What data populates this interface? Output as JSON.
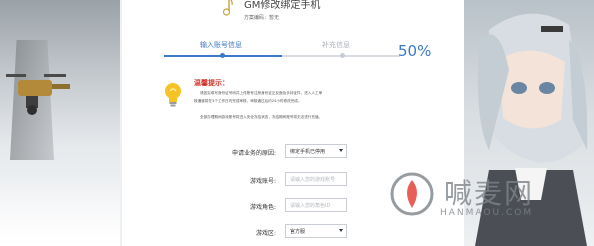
{
  "header": {
    "title": "GM修改绑定手机",
    "subtitle": "方案编码：暂无"
  },
  "progress": {
    "step1_label": "输入账号信息",
    "step2_label": "补充信息",
    "percent_text": "50%",
    "fraction": 0.5,
    "accent": "#3b78c7",
    "inactive": "#a9b1ba"
  },
  "tip": {
    "title": "温馨提示：",
    "title_color": "#d6322b",
    "lines": [
      "请如实填写身份证号码并上传账号注册身份证正反面及手持证件，进入人工审",
      "核通道将在3个工作日内完成审核，审核通过后约24小时修改完成。",
      "",
      "全部办理期间游戏账号将进入安全冻结状态，冻结期间账号将无法进行充值。"
    ]
  },
  "form": {
    "reason": {
      "label": "申请业务的原因:",
      "value": "绑定手机已停用"
    },
    "account": {
      "label": "游戏账号:",
      "placeholder": "请输入您的游戏账号"
    },
    "role": {
      "label": "游戏角色:",
      "placeholder": "请输入您的角色ID"
    },
    "server": {
      "label": "游戏区:",
      "value": "官方服"
    }
  },
  "watermark": {
    "brand": "喊麦网",
    "url": "HANMAOU.COM"
  }
}
